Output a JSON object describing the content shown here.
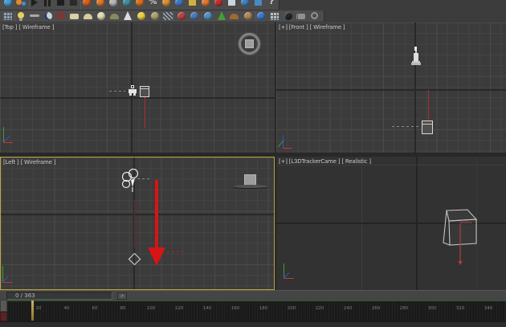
{
  "toolbar_row1": {
    "icons": [
      {
        "name": "sphere-blue-icon",
        "shape": "circle",
        "color": "#3f9fd8"
      },
      {
        "name": "dot-orange-icon",
        "shape": "twodot",
        "color": "#e08a28"
      },
      {
        "name": "play-icon",
        "shape": "play",
        "color": "#1e1e1e"
      },
      {
        "name": "pause-icon",
        "shape": "pause",
        "color": "#1e1e1e"
      },
      {
        "name": "stop-icon",
        "shape": "stop",
        "color": "#1e1e1e"
      },
      {
        "name": "ghost-icon",
        "shape": "stop",
        "color": "#2a2a2a"
      },
      {
        "name": "flame-icon",
        "shape": "circle",
        "color": "#d86018"
      },
      {
        "name": "flame2-icon",
        "shape": "circle",
        "color": "#e07828"
      },
      {
        "name": "checker-sphere-icon",
        "shape": "circle",
        "color": "#b8b8b8"
      },
      {
        "name": "globe-teal-icon",
        "shape": "circle",
        "color": "#3f8fa0"
      },
      {
        "name": "flame3-icon",
        "shape": "circle",
        "color": "#d8701c"
      },
      {
        "name": "percent-icon",
        "shape": "glyph",
        "color": "#cccccc",
        "glyph": "%"
      },
      {
        "name": "teapot-orange-icon",
        "shape": "circle",
        "color": "#d89030"
      },
      {
        "name": "person-blue-icon",
        "shape": "circle",
        "color": "#4078c0"
      },
      {
        "name": "cylinder-yellow-icon",
        "shape": "stop",
        "color": "#d0b040"
      },
      {
        "name": "figure-orange-icon",
        "shape": "circle",
        "color": "#e07830"
      },
      {
        "name": "sphere-red-icon",
        "shape": "circle",
        "color": "#c03030"
      },
      {
        "name": "box-light-icon",
        "shape": "stop",
        "color": "#ccd4dc"
      },
      {
        "name": "teapot-blue-icon",
        "shape": "circle",
        "color": "#4080c0"
      },
      {
        "name": "box-blue-icon",
        "shape": "stop",
        "color": "#4a88c8"
      },
      {
        "name": "help-icon",
        "shape": "glyph",
        "color": "#e0e0e0",
        "glyph": "?"
      }
    ]
  },
  "toolbar_row2": {
    "icons": [
      {
        "name": "schematic-view-icon",
        "shape": "grid",
        "color": "#8aa4b8"
      },
      {
        "name": "light-bulb-icon",
        "shape": "bulb",
        "color": "#e8d060"
      },
      {
        "name": "wrench-icon",
        "shape": "wrench",
        "color": "#a8a8a8"
      },
      {
        "name": "moon-icon",
        "shape": "crescent",
        "color": "#c8d0d8"
      },
      {
        "name": "gear-red-icon",
        "shape": "ring",
        "color": "#a82424"
      },
      {
        "name": "slab-beige-icon",
        "shape": "slab",
        "color": "#d8cfa4"
      },
      {
        "name": "dome-beige-icon",
        "shape": "dome",
        "color": "#d6cd9e"
      },
      {
        "name": "glow-sphere-icon",
        "shape": "circle",
        "color": "#e4dcb4"
      },
      {
        "name": "blob-olive-icon",
        "shape": "dome",
        "color": "#8a8a5a"
      },
      {
        "name": "cone-white-icon",
        "shape": "cone",
        "color": "#dcdcdc"
      },
      {
        "name": "sun-icon",
        "shape": "circle",
        "color": "#f0d040"
      },
      {
        "name": "sphere-tan-icon",
        "shape": "circle",
        "color": "#b0a070"
      },
      {
        "name": "exclude-arrows-icon",
        "shape": "diag",
        "color": "#9ab0c0"
      },
      {
        "name": "ball-red-icon",
        "shape": "circle",
        "color": "#c04040"
      },
      {
        "name": "controller-blue-icon",
        "shape": "circle",
        "color": "#4a7ab0"
      },
      {
        "name": "globe-swirl-icon",
        "shape": "circle",
        "color": "#5090c8"
      },
      {
        "name": "leaf-green-icon",
        "shape": "cone",
        "color": "#4a9a3a"
      },
      {
        "name": "fox-brown-icon",
        "shape": "dome",
        "color": "#a06a30"
      },
      {
        "name": "head-tan-icon",
        "shape": "circle",
        "color": "#b08858"
      },
      {
        "name": "marble-blue-icon",
        "shape": "circle",
        "color": "#3a78d0"
      },
      {
        "name": "clipboard-icon",
        "shape": "grid",
        "color": "#b8c0c8"
      },
      {
        "name": "eclipse-icon",
        "shape": "circle",
        "color": "#202830"
      },
      {
        "name": "phone-icon",
        "shape": "slab",
        "color": "#909090"
      },
      {
        "name": "help-circle-icon",
        "shape": "ring",
        "color": "#909090"
      }
    ]
  },
  "viewports": {
    "top_left": {
      "label": "[Top ] [ Wireframe ]"
    },
    "top_right": {
      "label": "[+] [Front ] [ Wireframe ]"
    },
    "bottom_left": {
      "label": "[Left ] [ Wireframe ]"
    },
    "bottom_right": {
      "label": "[+] [L3DTrackerCame ] [ Realistic ]"
    }
  },
  "time_slider": {
    "frame_indicator": "0 / 363",
    "next_button": ">"
  },
  "track_bar": {
    "tick_labels": [
      "20",
      "40",
      "60",
      "80",
      "100",
      "120",
      "140",
      "160",
      "180",
      "200",
      "220",
      "240",
      "260",
      "280",
      "300",
      "320",
      "340"
    ]
  }
}
